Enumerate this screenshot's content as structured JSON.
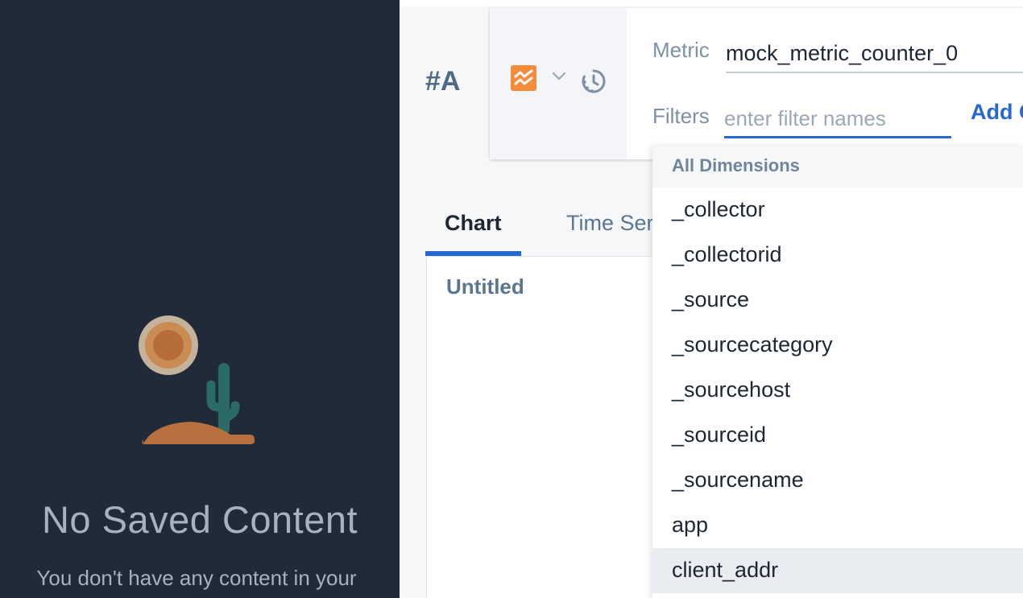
{
  "sidebar": {
    "empty_title": "No Saved Content",
    "empty_description": "You don't have any content in your"
  },
  "query": {
    "label": "#A",
    "metric_label": "Metric",
    "metric_value": "mock_metric_counter_0",
    "filters_label": "Filters",
    "filters_placeholder": "enter filter names",
    "filters_value": "",
    "add_link": "Add C"
  },
  "tabs": [
    {
      "label": "Chart",
      "active": true
    },
    {
      "label": "Time Ser",
      "active": false
    }
  ],
  "chart": {
    "title": "Untitled"
  },
  "dropdown": {
    "header": "All Dimensions",
    "items": [
      {
        "label": "_collector"
      },
      {
        "label": "_collectorid"
      },
      {
        "label": "_source"
      },
      {
        "label": "_sourcecategory"
      },
      {
        "label": "_sourcehost"
      },
      {
        "label": "_sourceid"
      },
      {
        "label": "_sourcename"
      },
      {
        "label": "app"
      },
      {
        "label": "client_addr",
        "highlighted": true
      }
    ]
  },
  "icons": {
    "query_type": "metrics-chart-icon",
    "type_menu": "chevron-down-icon",
    "time_shift": "timer-icon"
  },
  "colors": {
    "sidebar_bg": "#212a38",
    "accent": "#2568d2",
    "metrics_icon": "#f58c3b"
  }
}
